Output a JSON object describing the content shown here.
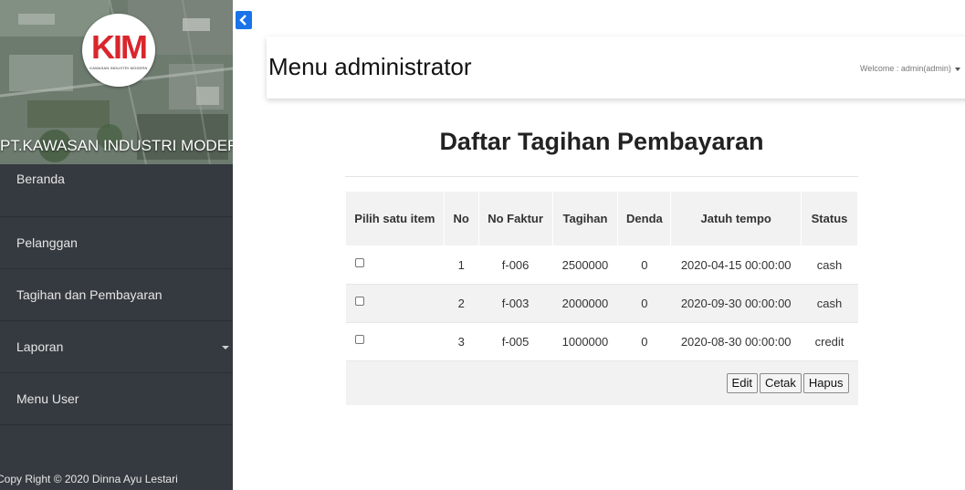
{
  "sidebar": {
    "company_name": "PT.KAWASAN INDUSTRI MODERN",
    "logo_text": "KIM",
    "logo_subtext": "KAWASAN INDUSTRI MODERN",
    "items": [
      {
        "label": "Beranda"
      },
      {
        "label": "Pelanggan"
      },
      {
        "label": "Tagihan dan Pembayaran"
      },
      {
        "label": "Laporan",
        "has_dropdown": true
      },
      {
        "label": "Menu User"
      }
    ],
    "footer": "Copy Right © 2020 Dinna Ayu Lestari"
  },
  "header": {
    "title": "Menu administrator",
    "welcome": "Welcome : admin(admin)"
  },
  "main": {
    "title": "Daftar Tagihan Pembayaran",
    "table": {
      "headers": [
        "Pilih satu item",
        "No",
        "No Faktur",
        "Tagihan",
        "Denda",
        "Jatuh tempo",
        "Status"
      ],
      "rows": [
        {
          "no": "1",
          "faktur": "f-006",
          "tagihan": "2500000",
          "denda": "0",
          "jatuh_tempo": "2020-04-15 00:00:00",
          "status": "cash"
        },
        {
          "no": "2",
          "faktur": "f-003",
          "tagihan": "2000000",
          "denda": "0",
          "jatuh_tempo": "2020-09-30 00:00:00",
          "status": "cash"
        },
        {
          "no": "3",
          "faktur": "f-005",
          "tagihan": "1000000",
          "denda": "0",
          "jatuh_tempo": "2020-08-30 00:00:00",
          "status": "credit"
        }
      ]
    },
    "buttons": {
      "edit": "Edit",
      "cetak": "Cetak",
      "hapus": "Hapus"
    }
  },
  "colors": {
    "sidebar_bg": "#353a40",
    "accent_blue": "#1a73e8",
    "logo_red": "#d9262c"
  },
  "icons": {
    "collapse": "chevron-left-icon",
    "dropdown": "caret-down-icon"
  }
}
